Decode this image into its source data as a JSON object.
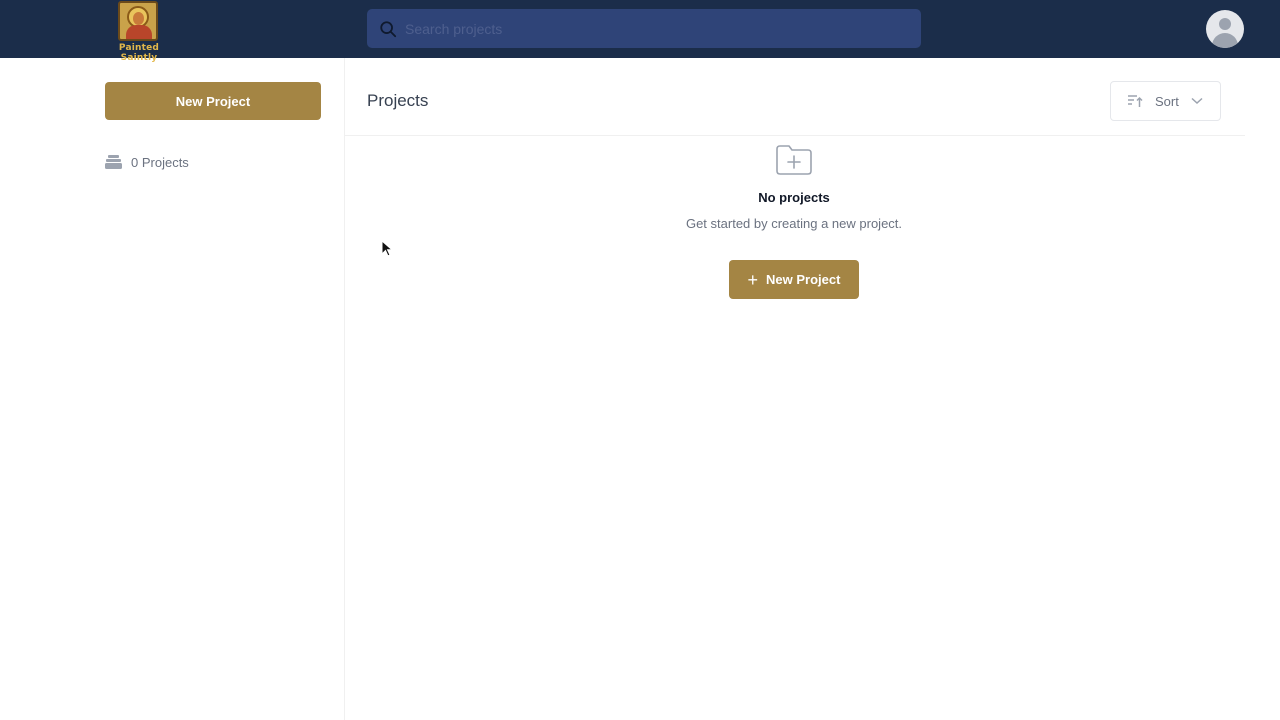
{
  "header": {
    "logo_text": "Painted Saintly",
    "search": {
      "placeholder": "Search projects",
      "value": ""
    },
    "avatar": "user-avatar"
  },
  "sidebar": {
    "new_project_label": "New Project",
    "project_count_label": "0 Projects",
    "project_count_icon": "inbox-stack-icon"
  },
  "main": {
    "title": "Projects",
    "sort_label": "Sort",
    "empty_state": {
      "icon": "folder-plus-icon",
      "title": "No projects",
      "description": "Get started by creating a new project.",
      "button_label": "New Project"
    }
  },
  "colors": {
    "header_bg": "#1b2d4a",
    "search_bg": "#2f4478",
    "accent_gold": "#a48544"
  }
}
